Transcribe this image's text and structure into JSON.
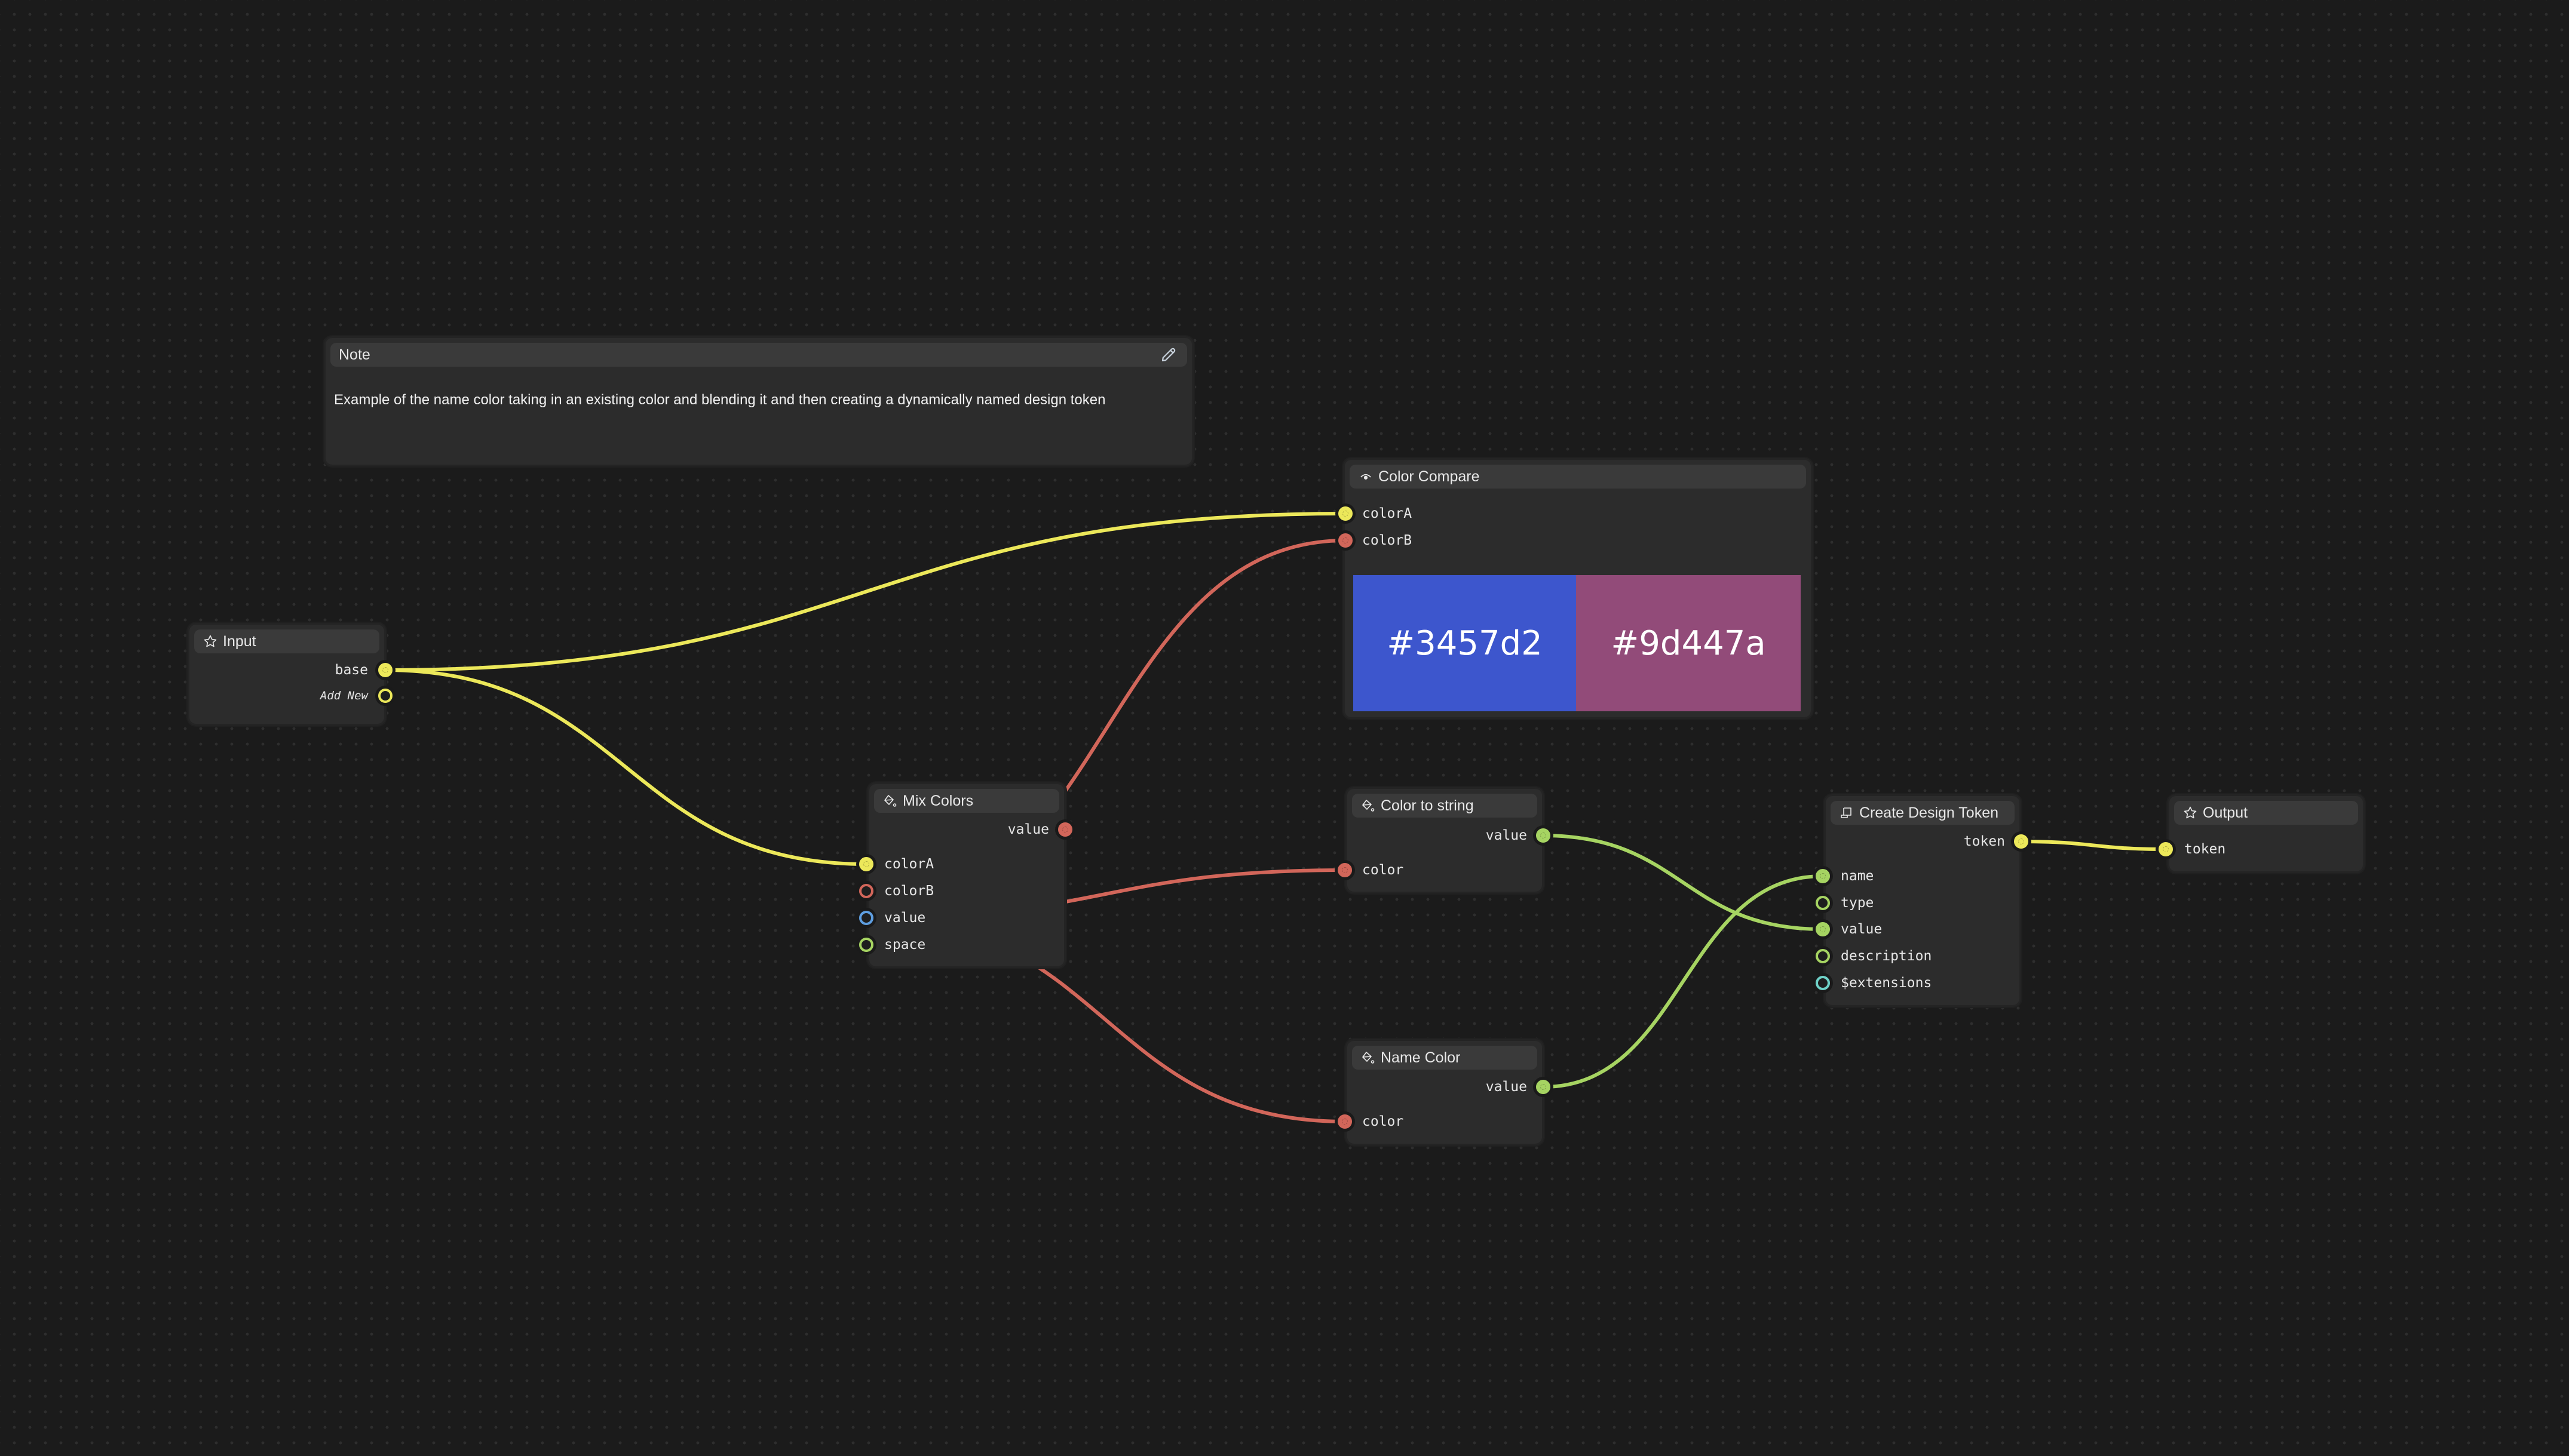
{
  "colors": {
    "canvas": "#1b1b1b",
    "wire_yellow": "#ece85a",
    "wire_red": "#d2665a",
    "wire_green": "#a6d462",
    "port_blue": "#5e9ee0",
    "port_teal": "#6fd2c8"
  },
  "note": {
    "title": "Note",
    "icon": "pencil-icon",
    "text": "Example of the name color taking in an existing color and blending it and then creating a dynamically named design token"
  },
  "nodes": {
    "input": {
      "title": "Input",
      "icon": "star-icon",
      "outputs": [
        {
          "label": "base",
          "connected": true,
          "color": "#ece85a"
        },
        {
          "label": "Add New",
          "connected": false,
          "color": "#ece85a"
        }
      ]
    },
    "color_compare": {
      "title": "Color Compare",
      "icon": "eye-icon",
      "inputs": [
        {
          "label": "colorA",
          "connected": true,
          "color": "#ece85a"
        },
        {
          "label": "colorB",
          "connected": true,
          "color": "#d2665a"
        }
      ],
      "swatches": [
        {
          "label": "#3457d2",
          "color": "#3d56cd"
        },
        {
          "label": "#9d447a",
          "color": "#924b79"
        }
      ]
    },
    "mix_colors": {
      "title": "Mix Colors",
      "icon": "paint-bucket-icon",
      "outputs": [
        {
          "label": "value",
          "connected": true,
          "color": "#d2665a"
        }
      ],
      "inputs": [
        {
          "label": "colorA",
          "connected": true,
          "color": "#ece85a"
        },
        {
          "label": "colorB",
          "connected": false,
          "color": "#d2665a"
        },
        {
          "label": "value",
          "connected": false,
          "color": "#5e9ee0"
        },
        {
          "label": "space",
          "connected": false,
          "color": "#a6d462"
        }
      ]
    },
    "color_to_string": {
      "title": "Color to string",
      "icon": "paint-bucket-icon",
      "outputs": [
        {
          "label": "value",
          "connected": true,
          "color": "#a6d462"
        }
      ],
      "inputs": [
        {
          "label": "color",
          "connected": true,
          "color": "#d2665a"
        }
      ]
    },
    "name_color": {
      "title": "Name Color",
      "icon": "paint-bucket-icon",
      "outputs": [
        {
          "label": "value",
          "connected": true,
          "color": "#a6d462"
        }
      ],
      "inputs": [
        {
          "label": "color",
          "connected": true,
          "color": "#d2665a"
        }
      ]
    },
    "create_design_token": {
      "title": "Create Design Token",
      "icon": "token-icon",
      "outputs": [
        {
          "label": "token",
          "connected": true,
          "color": "#ece85a"
        }
      ],
      "inputs": [
        {
          "label": "name",
          "connected": true,
          "color": "#a6d462"
        },
        {
          "label": "type",
          "connected": false,
          "color": "#a6d462"
        },
        {
          "label": "value",
          "connected": true,
          "color": "#a6d462"
        },
        {
          "label": "description",
          "connected": false,
          "color": "#a6d462"
        },
        {
          "label": "$extensions",
          "connected": false,
          "color": "#6fd2c8"
        }
      ]
    },
    "output": {
      "title": "Output",
      "icon": "star-icon",
      "inputs": [
        {
          "label": "token",
          "connected": true,
          "color": "#ece85a"
        }
      ]
    }
  },
  "edges": [
    {
      "from": "input.base",
      "to": "color_compare.colorA",
      "color": "#ece85a"
    },
    {
      "from": "input.base",
      "to": "mix_colors.colorA",
      "color": "#ece85a"
    },
    {
      "from": "mix_colors.value",
      "to": "color_compare.colorB",
      "color": "#d2665a"
    },
    {
      "from": "mix_colors.value",
      "to": "color_to_string.color",
      "color": "#d2665a"
    },
    {
      "from": "mix_colors.value",
      "to": "name_color.color",
      "color": "#d2665a"
    },
    {
      "from": "color_to_string.value",
      "to": "create_design_token.value",
      "color": "#a6d462"
    },
    {
      "from": "name_color.value",
      "to": "create_design_token.name",
      "color": "#a6d462"
    },
    {
      "from": "create_design_token.token",
      "to": "output.token",
      "color": "#ece85a"
    }
  ]
}
